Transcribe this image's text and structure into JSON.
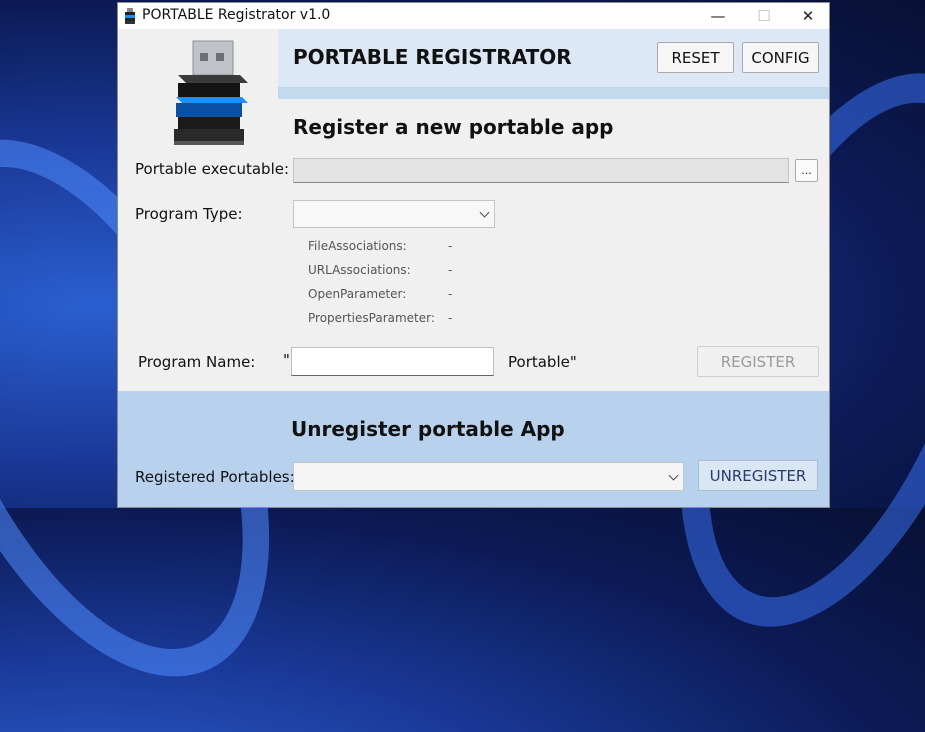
{
  "window": {
    "title": "PORTABLE Registrator v1.0",
    "controls": {
      "minimize": "—",
      "maximize": "☐",
      "close": "✕"
    }
  },
  "header": {
    "title": "PORTABLE REGISTRATOR",
    "reset_label": "RESET",
    "config_label": "CONFIG"
  },
  "register": {
    "section_title": "Register a new portable app",
    "exe_label": "Portable executable:",
    "exe_value": "",
    "browse_label": "...",
    "type_label": "Program Type:",
    "type_value": "",
    "associations": [
      {
        "key": "FileAssociations:",
        "value": "-"
      },
      {
        "key": "URLAssociations:",
        "value": "-"
      },
      {
        "key": "OpenParameter:",
        "value": "-"
      },
      {
        "key": "PropertiesParameter:",
        "value": "-"
      }
    ],
    "name_label": "Program Name:",
    "quote_open": "\"",
    "name_value": "",
    "suffix": "Portable\"",
    "register_label": "REGISTER"
  },
  "unregister": {
    "section_title": "Unregister portable App",
    "registered_label": "Registered Portables:",
    "registered_value": "",
    "unregister_label": "UNREGISTER"
  },
  "colors": {
    "header_band": "#dce8f5",
    "bottom_band": "#b8d1ec",
    "usb_blue": "#1f8fff"
  }
}
